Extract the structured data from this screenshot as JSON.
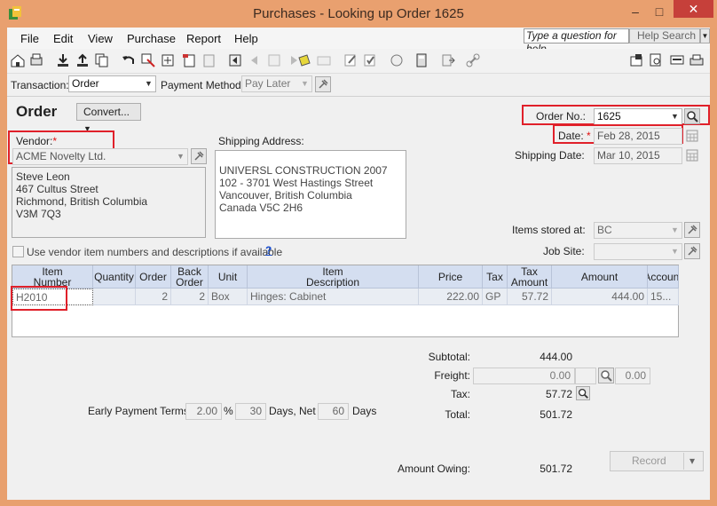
{
  "window": {
    "title": "Purchases - Looking up Order 1625",
    "minimize": "–",
    "maximize": "□",
    "close": "✕"
  },
  "menu": {
    "items": [
      "File",
      "Edit",
      "View",
      "Purchase",
      "Report",
      "Help"
    ],
    "help_placeholder": "Type a question for help",
    "help_search": "Help Search"
  },
  "toolbar": {
    "icons": [
      "home-icon",
      "print-icon",
      "save-icon",
      "upload-icon",
      "copy-icon",
      "undo-icon",
      "recall-icon",
      "calc-icon",
      "journal-icon",
      "printer-icon",
      "first-icon",
      "prev-icon",
      "next-icon",
      "last-icon",
      "note-icon",
      "email-icon",
      "edit-icon",
      "approve-icon",
      "refresh-icon",
      "calculator-icon",
      "export-icon",
      "link-icon"
    ],
    "right_icons": [
      "reports-icon",
      "preview-icon",
      "chat-icon",
      "print-right-icon"
    ]
  },
  "transaction": {
    "label": "Transaction:",
    "value": "Order",
    "payment_label": "Payment Method:",
    "payment_value": "Pay Later"
  },
  "form": {
    "title": "Order",
    "convert": "Convert...",
    "vendor_label": "Vendor:",
    "vendor_required": "*",
    "vendor_value": "ACME Novelty Ltd.",
    "vendor_address": [
      "Steve Leon",
      "467 Cultus Street",
      "Richmond, British Columbia",
      "V3M 7Q3"
    ],
    "shipping_label": "Shipping Address:",
    "shipping_address": [
      "UNIVERSL CONSTRUCTION 2007",
      "102 - 3701 West Hastings Street",
      "Vancouver, British Columbia",
      "Canada V5C 2H6"
    ],
    "order_no_label": "Order No.:",
    "order_no_value": "1625",
    "date_label": "Date:",
    "date_required": "*",
    "date_value": "Feb 28, 2015",
    "shipping_date_label": "Shipping Date:",
    "shipping_date_value": "Mar 10, 2015",
    "items_stored_label": "Items stored at:",
    "items_stored_value": "BC",
    "job_site_label": "Job Site:",
    "job_site_value": "",
    "vendor_item_checkbox": "Use vendor item numbers and descriptions if available",
    "help_link": "?"
  },
  "grid": {
    "headers": [
      "Item\nNumber",
      "Quantity",
      "Order",
      "Back\nOrder",
      "Unit",
      "Item\nDescription",
      "Price",
      "Tax",
      "Tax\nAmount",
      "Amount",
      "Account"
    ],
    "rows": [
      [
        "H2010",
        "",
        "2",
        "2",
        "Box",
        "Hinges: Cabinet",
        "222.00",
        "GP",
        "57.72",
        "444.00",
        "15..."
      ]
    ]
  },
  "totals": {
    "subtotal_label": "Subtotal:",
    "subtotal_value": "444.00",
    "freight_label": "Freight:",
    "freight_value": "0.00",
    "freight_tax": "0.00",
    "tax_label": "Tax:",
    "tax_value": "57.72",
    "total_label": "Total:",
    "total_value": "501.72",
    "amount_owing_label": "Amount Owing:",
    "amount_owing_value": "501.72"
  },
  "terms": {
    "label": "Early Payment Terms:",
    "percent": "2.00",
    "percent_sign": "%",
    "days": "30",
    "days_net_label": "Days, Net",
    "net": "60",
    "days_label": "Days"
  },
  "record_button": "Record",
  "record_drop": "▾",
  "colors": {
    "titlebar": "#e9a06f",
    "highlight": "#e0202a",
    "grid_header": "#d4def0"
  }
}
